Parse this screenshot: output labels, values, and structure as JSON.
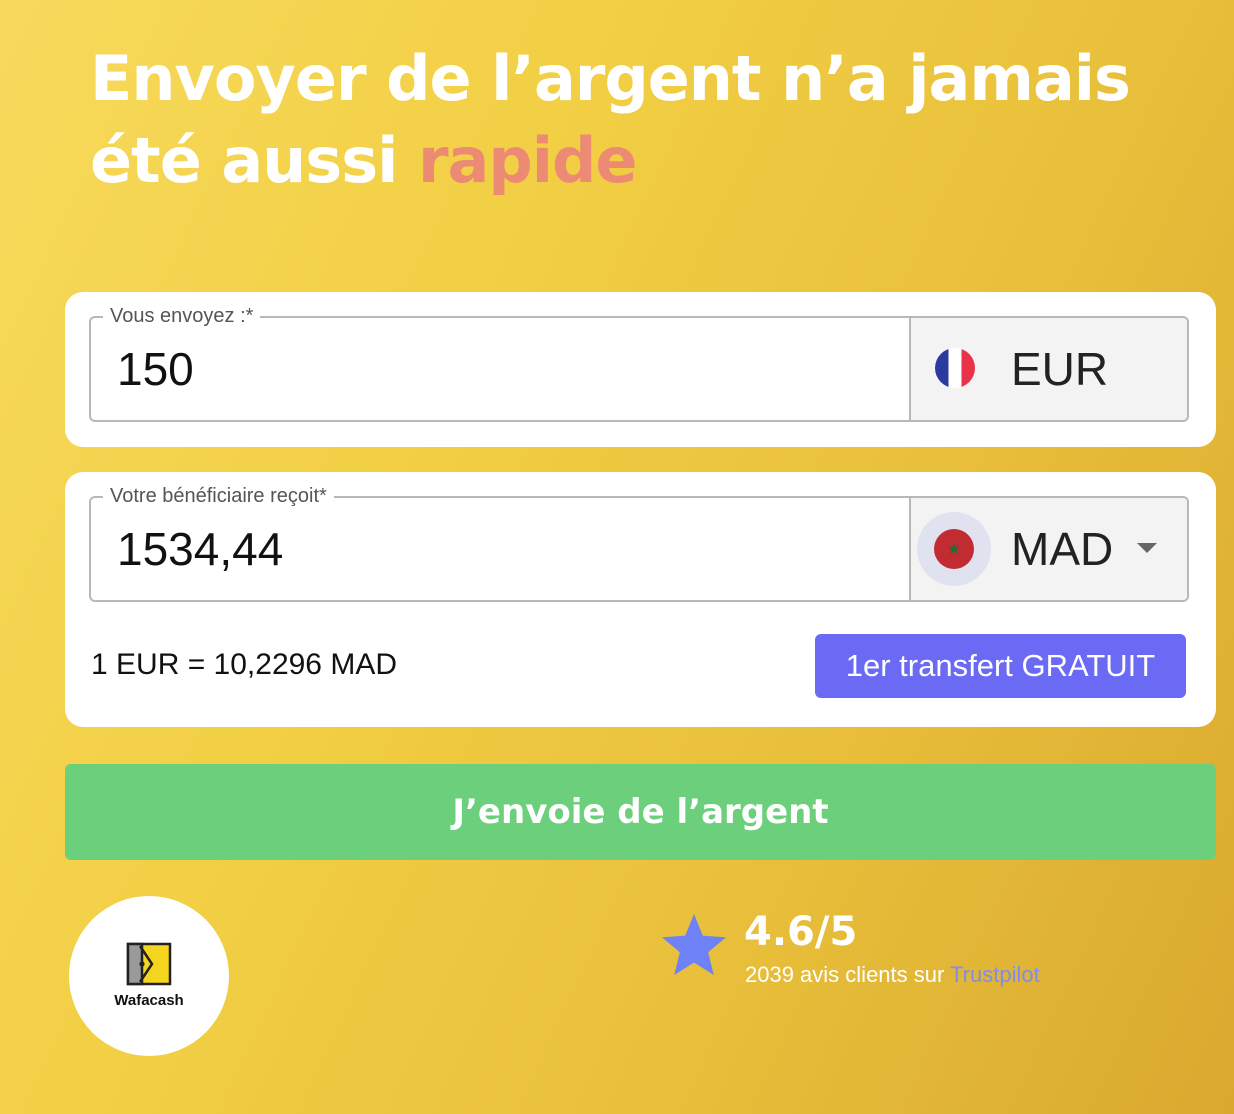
{
  "hero": {
    "title_main": "Envoyer de l’argent n’a jamais été aussi ",
    "title_accent": "rapide",
    "accent_color": "#ec8a74"
  },
  "send": {
    "label": "Vous envoyez :*",
    "amount": "150",
    "currency": "EUR",
    "flag_icon": "france-flag-icon"
  },
  "receive": {
    "label": "Votre bénéficiaire reçoit*",
    "amount": "1534,44",
    "currency": "MAD",
    "flag_icon": "morocco-flag-icon",
    "flag_emblem": "★"
  },
  "rate": {
    "text": "1 EUR = 10,2296 MAD"
  },
  "promo": {
    "label": "1er transfert GRATUIT",
    "color": "#6b6af4"
  },
  "cta": {
    "label": "J’envoie de l’argent",
    "color": "#6ccf7c"
  },
  "partner": {
    "name": "Wafacash",
    "logo_icon": "wafacash-logo-icon"
  },
  "rating": {
    "score": "4.6/5",
    "reviews_text": "2039 avis clients sur ",
    "platform": "Trustpilot",
    "star_color": "#6f82f5",
    "icon": "star-icon"
  }
}
